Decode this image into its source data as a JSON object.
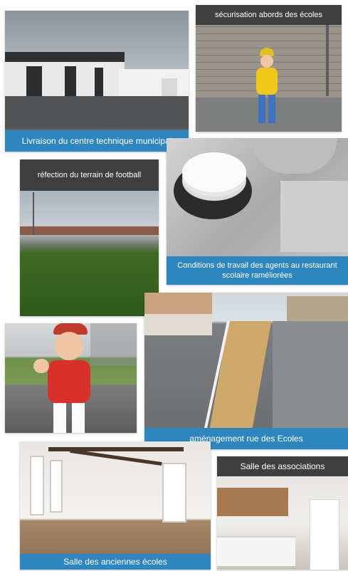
{
  "tiles": [
    {
      "caption": "Livraison du centre technique municipal"
    },
    {
      "caption": "sécurisation abords des écoles"
    },
    {
      "caption": "réfection du terrain de football"
    },
    {
      "caption": "Conditions de travail des agents au restaurant scolaire raméliorées"
    },
    {
      "caption": "aménagement rue des Ecoles"
    },
    {
      "caption": "Salle des anciennes écoles"
    },
    {
      "caption": "Salle des associations"
    }
  ]
}
